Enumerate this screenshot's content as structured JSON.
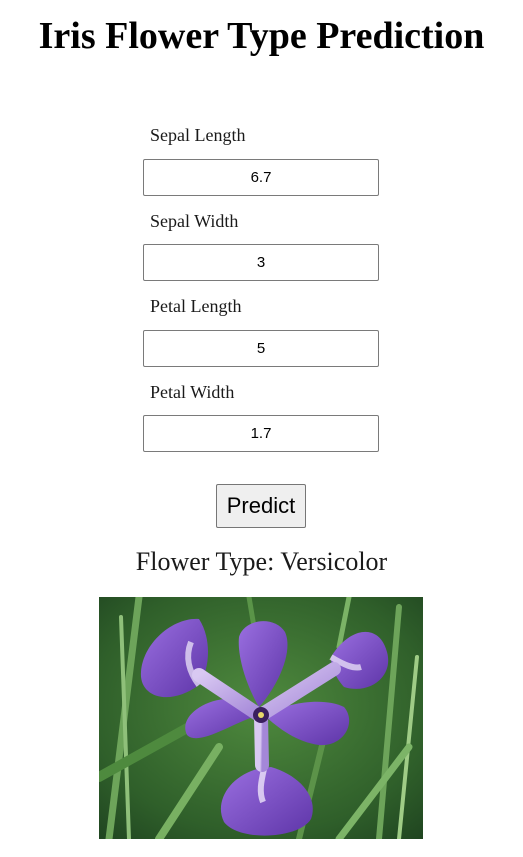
{
  "page": {
    "title": "Iris Flower Type Prediction"
  },
  "form": {
    "fields": [
      {
        "label": "Sepal Length",
        "value": "6.7"
      },
      {
        "label": "Sepal Width",
        "value": "3"
      },
      {
        "label": "Petal Length",
        "value": "5"
      },
      {
        "label": "Petal Width",
        "value": "1.7"
      }
    ],
    "submit_label": "Predict"
  },
  "result": {
    "text": "Flower Type: Versicolor"
  },
  "image": {
    "alt": "iris versicolor flower"
  },
  "colors": {
    "background": "#ffffff",
    "text": "#000000",
    "input_border": "#7a7a7a",
    "button_background": "#efefef",
    "petal_purple": "#7b4fc4",
    "foliage_green": "#3f7a34"
  }
}
